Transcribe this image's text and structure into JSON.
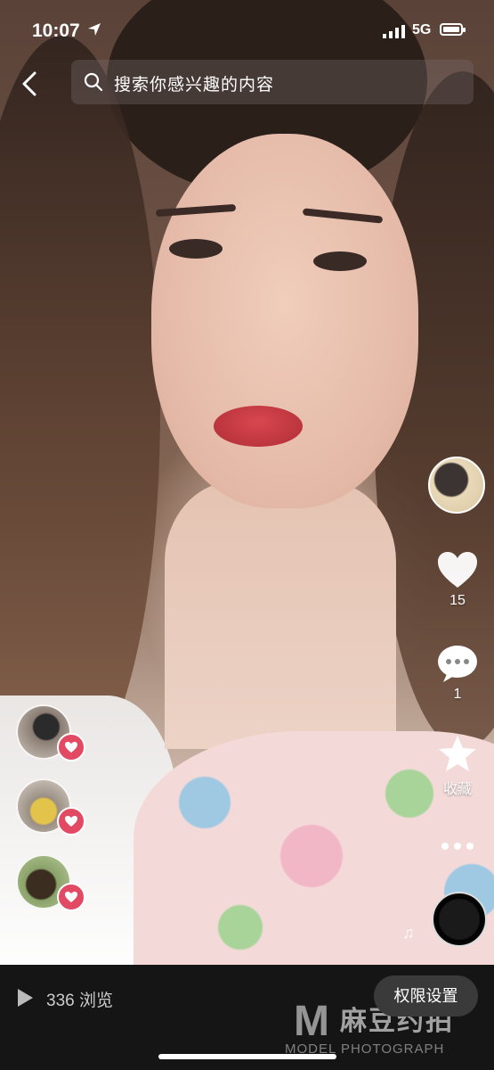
{
  "status_bar": {
    "time": "10:07",
    "network": "5G"
  },
  "search": {
    "placeholder": "搜索你感兴趣的内容"
  },
  "actions": {
    "like_count": "15",
    "comment_count": "1",
    "collect_label": "收藏"
  },
  "bottom_bar": {
    "views_label": "336 浏览",
    "permission_button": "权限设置"
  },
  "watermark": {
    "letter": "M",
    "brand_cn": "麻豆约拍",
    "brand_en": "MODEL PHOTOGRAPH"
  },
  "colors": {
    "like_heart": "#e24a63",
    "bottom_bar_bg": "#151515"
  },
  "icons": [
    "back-arrow-icon",
    "search-icon",
    "heart-icon",
    "comment-icon",
    "star-icon",
    "more-icon",
    "music-note-icon",
    "play-icon"
  ]
}
